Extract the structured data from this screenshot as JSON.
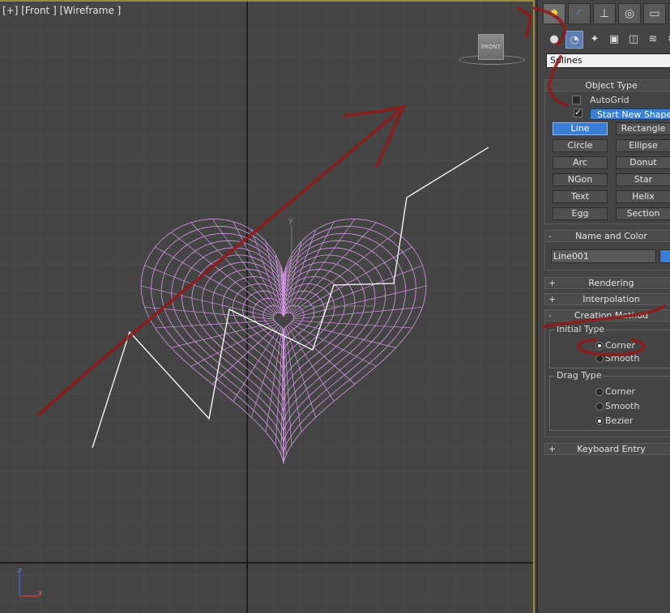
{
  "viewport": {
    "label": "[+] [Front ] [Wireframe ]",
    "viewcube_label": "FRONT",
    "axis_y": "y",
    "gizmo_z": "z",
    "gizmo_x": "x"
  },
  "panel": {
    "tabs": [
      "create-tab",
      "modify-tab",
      "hierarchy-tab",
      "motion-tab",
      "display-tab",
      "utilities-tab"
    ],
    "subtabs": [
      "geometry",
      "shapes",
      "lights",
      "cameras",
      "helpers",
      "spacewarps",
      "systems"
    ],
    "category_dropdown": "Splines",
    "object_type": {
      "title": "Object Type",
      "autogrid": "AutoGrid",
      "start_new_shape": "Start New Shape",
      "buttons": [
        "Line",
        "Rectangle",
        "Circle",
        "Ellipse",
        "Arc",
        "Donut",
        "NGon",
        "Star",
        "Text",
        "Helix",
        "Egg",
        "Section"
      ],
      "active": "Line"
    },
    "name_and_color": {
      "title": "Name and Color",
      "name_value": "Line001",
      "color": "#3a7dd6"
    },
    "rendering": {
      "title": "Rendering"
    },
    "interpolation": {
      "title": "Interpolation"
    },
    "creation_method": {
      "title": "Creation Method",
      "initial_type_label": "Initial Type",
      "initial_options": [
        "Corner",
        "Smooth"
      ],
      "initial_selected": "Corner",
      "drag_type_label": "Drag Type",
      "drag_options": [
        "Corner",
        "Smooth",
        "Bezier"
      ],
      "drag_selected": "Bezier"
    },
    "keyboard_entry": {
      "title": "Keyboard Entry"
    },
    "minus": "-",
    "plus": "+",
    "check": "✓"
  }
}
